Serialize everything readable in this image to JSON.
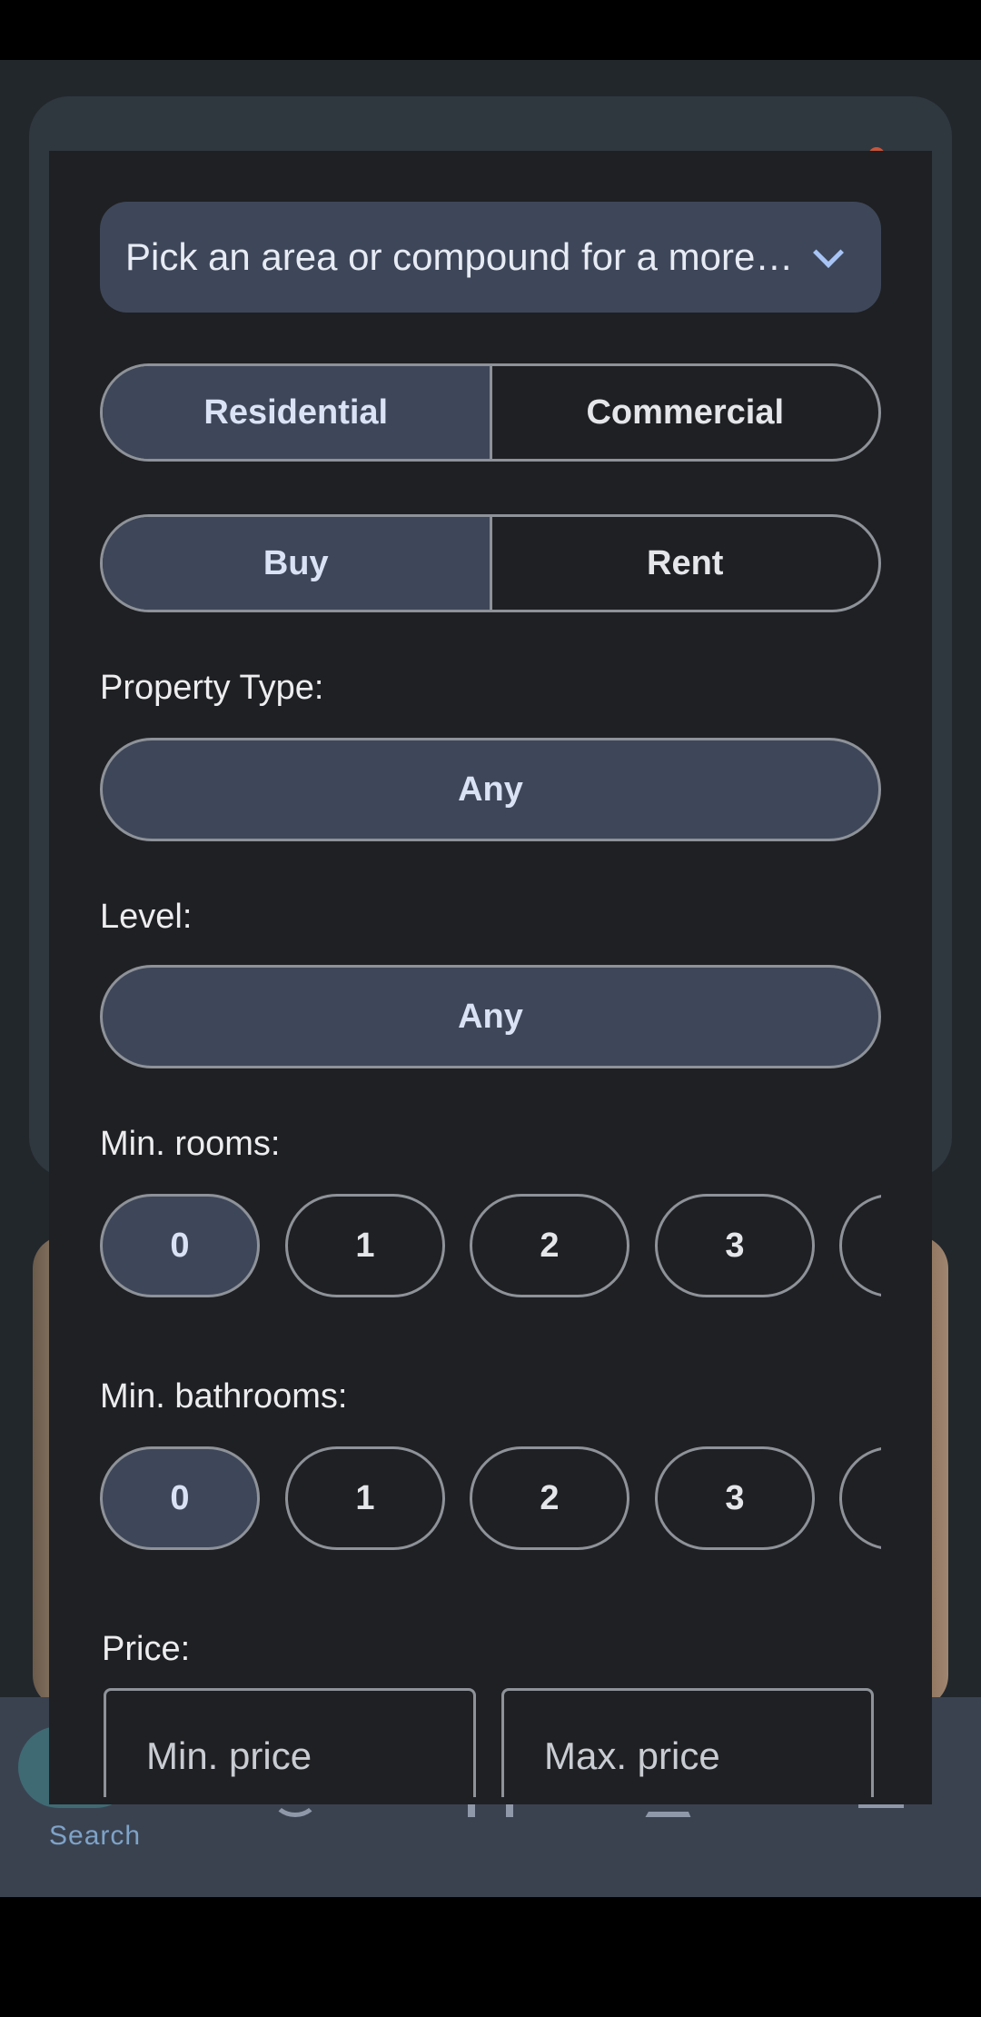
{
  "bottom_nav": {
    "search_label": "Search"
  },
  "filter": {
    "area_placeholder": "Pick an area or compound for a more accurate search",
    "category": {
      "options": [
        "Residential",
        "Commercial"
      ],
      "selected": "Residential"
    },
    "purpose": {
      "options": [
        "Buy",
        "Rent"
      ],
      "selected": "Buy"
    },
    "property_type": {
      "label": "Property Type:",
      "value": "Any"
    },
    "level": {
      "label": "Level:",
      "value": "Any"
    },
    "min_rooms": {
      "label": "Min. rooms:",
      "options": [
        "0",
        "1",
        "2",
        "3"
      ],
      "selected": "0"
    },
    "min_bathrooms": {
      "label": "Min. bathrooms:",
      "options": [
        "0",
        "1",
        "2",
        "3"
      ],
      "selected": "0"
    },
    "price": {
      "label": "Price:",
      "min_placeholder": "Min. price",
      "max_placeholder": "Max. price"
    }
  },
  "colors": {
    "modal_bg": "#1f2023",
    "active_fill": "#3e4759",
    "outline": "#8e9299",
    "accent_text": "#d9e3f5"
  }
}
